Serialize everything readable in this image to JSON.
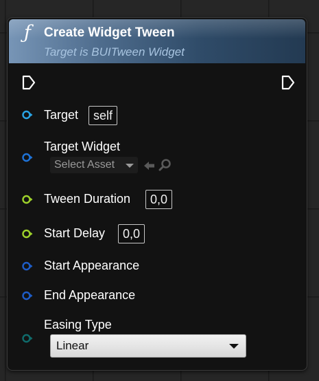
{
  "node": {
    "func_icon": "ƒ",
    "title": "Create Widget Tween",
    "subtitle": "Target is BUITween Widget"
  },
  "exec": {
    "in_icon": "exec-in-pin-icon",
    "out_icon": "exec-out-pin-icon"
  },
  "pins": {
    "target": {
      "label": "Target",
      "value": "self",
      "color": "#29a5e6"
    },
    "target_widget": {
      "label": "Target Widget",
      "asset_select": "Select Asset",
      "color": "#1e73d8"
    },
    "tween_duration": {
      "label": "Tween Duration",
      "value": "0,0",
      "color": "#9ed22b"
    },
    "start_delay": {
      "label": "Start Delay",
      "value": "0,0",
      "color": "#9ed22b"
    },
    "start_appearance": {
      "label": "Start Appearance",
      "color": "#1e5dc8"
    },
    "end_appearance": {
      "label": "End Appearance",
      "color": "#1e5dc8"
    },
    "easing_type": {
      "label": "Easing Type",
      "value": "Linear",
      "color": "#0f6b6b"
    }
  }
}
